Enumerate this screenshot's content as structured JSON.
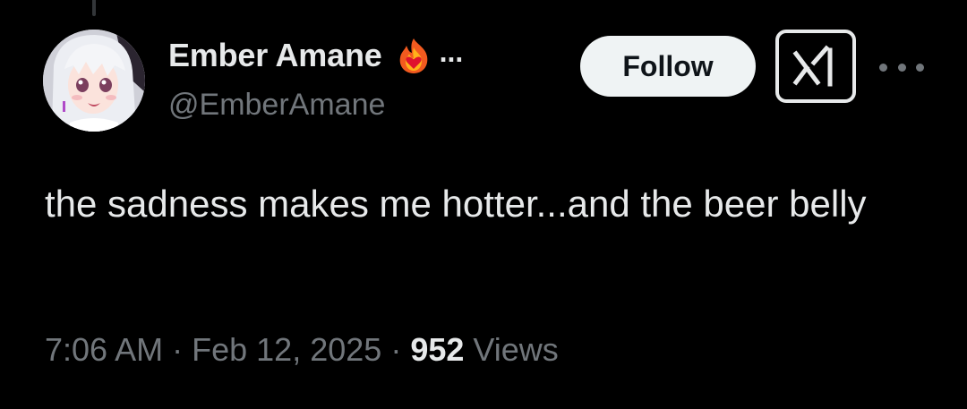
{
  "tweet": {
    "author": {
      "display_name": "Ember Amane",
      "badge_icon": "fire-heart-icon",
      "truncation": "...",
      "handle": "@EmberAmane"
    },
    "follow_label": "Follow",
    "grok_icon": "grok-icon",
    "more_icon": "more-options-icon",
    "text": "the sadness makes me hotter...and the beer belly",
    "meta": {
      "time": "7:06 AM",
      "separator": "·",
      "date": "Feb 12, 2025",
      "views_count": "952",
      "views_label": "Views"
    }
  },
  "colors": {
    "background": "#000000",
    "primary_text": "#e7e9ea",
    "secondary_text": "#71767b",
    "follow_bg": "#eff3f4",
    "follow_text": "#0f1419"
  }
}
